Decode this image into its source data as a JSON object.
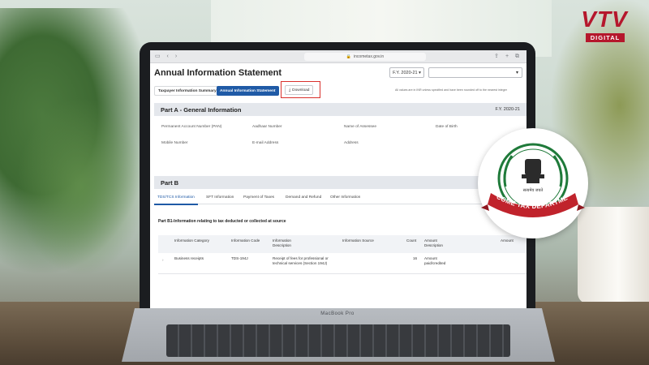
{
  "browser": {
    "url": "incometax.gov.in"
  },
  "page": {
    "title": "Annual Information Statement",
    "fy_selected": "F.Y. 2020-21",
    "wide_select_value": ""
  },
  "tabs": {
    "taxpayer_summary": "Taxpayer Information Summary",
    "annual_statement": "Annual Information Statement",
    "download": "Download"
  },
  "note": "All values are in INR unless specified and have been rounded off to the nearest integer",
  "partA": {
    "title": "Part A - General Information",
    "fy": "F.Y. 2020-21",
    "fields": {
      "pan": "Permanent Account Number (PAN)",
      "aadhaar": "Aadhaar Number",
      "name": "Name of Assessee",
      "dob": "Date of Birth",
      "mobile": "Mobile Number",
      "email": "E-mail Address",
      "address": "Address"
    }
  },
  "partB": {
    "title": "Part B",
    "subtabs": [
      "TDS/TCS Information",
      "SFT Information",
      "Payment of Taxes",
      "Demand and Refund",
      "Other Information"
    ],
    "b1_title": "Part B1-Information relating to tax deducted or collected at source",
    "columns": {
      "category": "Information Category",
      "code": "Information Code",
      "description": "Information Description",
      "source": "Information Source",
      "count": "Count",
      "amount_desc": "Amount Description",
      "amount": "Amount"
    },
    "rows": [
      {
        "category": "Business receipts",
        "code": "TDS-194J",
        "description": "Receipt of fees for professional or technical services (Section 194J)",
        "source": "",
        "count": "16",
        "amount_desc": "Amount paid/credited",
        "amount": ""
      }
    ]
  },
  "branding": {
    "vtv": "VTV",
    "vtv_sub": "DIGITAL",
    "itd_ribbon": "INCOME TAX DEPARTMENT",
    "emblem_motto": "सत्यमेव जयते",
    "vtv_color": "#b5172c",
    "itd_color": "#1f7a3a",
    "ribbon_color": "#c0232c"
  },
  "laptop": {
    "model": "MacBook Pro"
  }
}
